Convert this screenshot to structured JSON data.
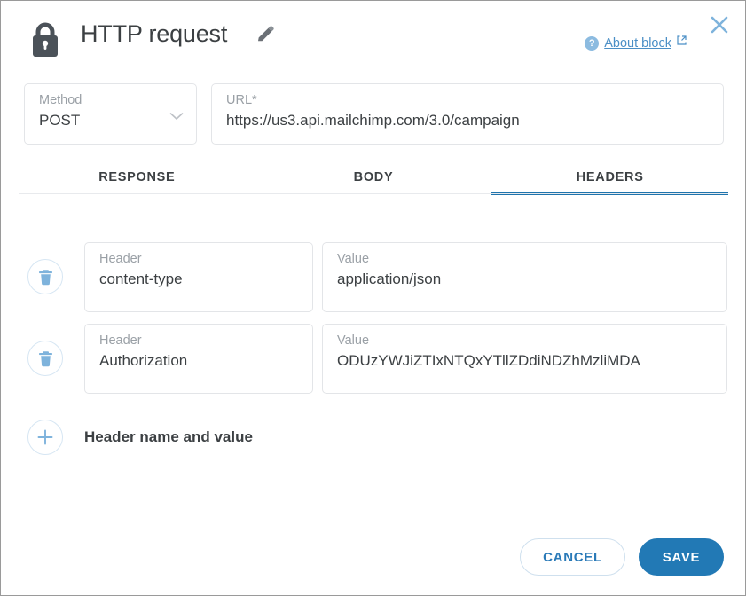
{
  "dialog": {
    "title": "HTTP request",
    "lock_icon": "lock-icon",
    "edit_icon": "pencil-edit-icon",
    "close_icon": "close-icon",
    "about": {
      "help_icon": "question-mark-circle-icon",
      "label": "About block",
      "external_icon": "external-link-icon"
    }
  },
  "request": {
    "method": {
      "label": "Method",
      "value": "POST",
      "chevron_icon": "chevron-down-icon"
    },
    "url": {
      "label": "URL*",
      "value": "https://us3.api.mailchimp.com/3.0/campaign",
      "placeholder": "URL"
    }
  },
  "tabs": [
    {
      "label": "RESPONSE",
      "active": false
    },
    {
      "label": "BODY",
      "active": false
    },
    {
      "label": "HEADERS",
      "active": true
    }
  ],
  "headers": {
    "key_label": "Header",
    "value_label": "Value",
    "delete_icon": "trash-icon",
    "rows": [
      {
        "key": "content-type",
        "value": "application/json"
      },
      {
        "key": "Authorization",
        "value": "ODUzYWJiZTIxNTQxYTllZDdiNDZhMzliMDA"
      }
    ],
    "add": {
      "icon": "plus-icon",
      "label": "Header name and value"
    }
  },
  "footer": {
    "cancel_label": "CANCEL",
    "save_label": "SAVE"
  },
  "colors": {
    "accent_blue": "#2279b5",
    "tab_underline": "#1f74ad",
    "link_blue": "#4b8fc6",
    "icon_blue": "#7eb3dc",
    "text_dark": "#3c4043",
    "label_gray": "#9aa0a6",
    "border_gray": "#e3e5e8"
  }
}
